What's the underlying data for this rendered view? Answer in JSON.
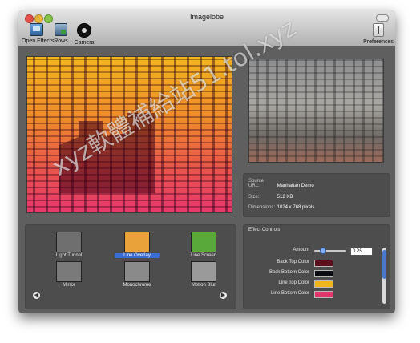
{
  "window": {
    "title": "Imagelobe"
  },
  "toolbar": {
    "open_effects": "Open Effects",
    "rows": "Rows",
    "camera": "Camera",
    "preferences": "Preferences"
  },
  "info": {
    "source_url_label": "Source URL:",
    "source_url_value": "Manhattan Demo",
    "size_label": "Size:",
    "size_value": "512 KB",
    "dimensions_label": "Dimensions:",
    "dimensions_value": "1024 x 768 pixels"
  },
  "effects": [
    {
      "label": "Light Tunnel",
      "thumb": "#6f6f6f"
    },
    {
      "label": "Line Overlay",
      "thumb": "#e9a23a",
      "selected": true
    },
    {
      "label": "Line Screen",
      "thumb": "#59a83a"
    },
    {
      "label": "Mirror",
      "thumb": "#7a7a7a"
    },
    {
      "label": "Monochrome",
      "thumb": "#8a8a8a"
    },
    {
      "label": "Motion Blur",
      "thumb": "#9a9a9a"
    }
  ],
  "controls": {
    "title": "Effect Controls",
    "amount_label": "Amount",
    "amount_value": "0.25",
    "amount": 0.25,
    "back_top_label": "Back Top Color",
    "back_top_color": "#5a0f1a",
    "back_bottom_label": "Back Bottom Color",
    "back_bottom_color": "#0b0b12",
    "line_top_label": "Line Top Color",
    "line_top_color": "#f1b51b",
    "line_bottom_label": "Line Bottom Color",
    "line_bottom_color": "#e0366c"
  },
  "watermark": "xyz軟體補給站51.tol.xyz"
}
